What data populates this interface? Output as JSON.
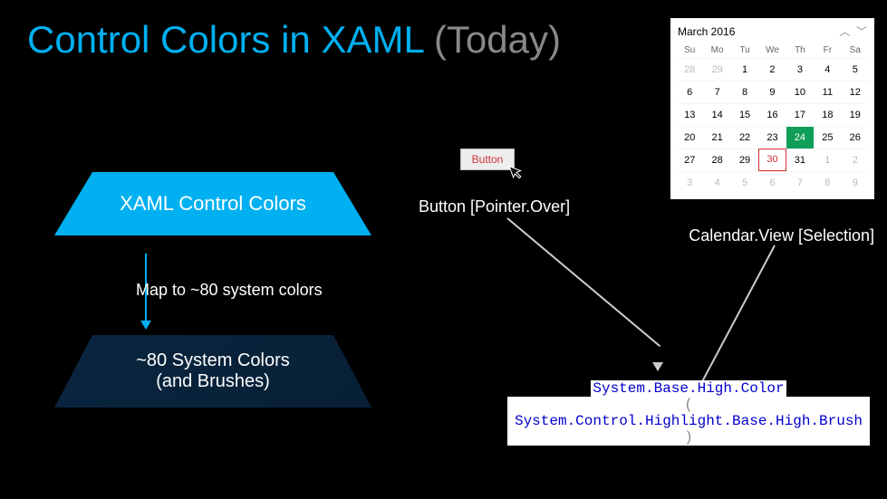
{
  "title": {
    "main": "Control Colors in XAML ",
    "muted": "(Today)"
  },
  "trapTop": "XAML Control Colors",
  "trapBotLine1": "~80 System Colors",
  "trapBotLine2": "(and Brushes)",
  "mapLabel": "Map to ~80 system colors",
  "buttonSample": "Button",
  "buttonLabel": "Button [Pointer.Over]",
  "calendar": {
    "monthLabel": "March 2016",
    "days": [
      "Su",
      "Mo",
      "Tu",
      "We",
      "Th",
      "Fr",
      "Sa"
    ],
    "rows": [
      [
        {
          "v": "28",
          "m": true
        },
        {
          "v": "29",
          "m": true
        },
        {
          "v": "1"
        },
        {
          "v": "2"
        },
        {
          "v": "3"
        },
        {
          "v": "4"
        },
        {
          "v": "5"
        }
      ],
      [
        {
          "v": "6"
        },
        {
          "v": "7"
        },
        {
          "v": "8"
        },
        {
          "v": "9"
        },
        {
          "v": "10"
        },
        {
          "v": "11"
        },
        {
          "v": "12"
        }
      ],
      [
        {
          "v": "13"
        },
        {
          "v": "14"
        },
        {
          "v": "15"
        },
        {
          "v": "16"
        },
        {
          "v": "17"
        },
        {
          "v": "18"
        },
        {
          "v": "19"
        }
      ],
      [
        {
          "v": "20"
        },
        {
          "v": "21"
        },
        {
          "v": "22"
        },
        {
          "v": "23"
        },
        {
          "v": "24",
          "sel": true
        },
        {
          "v": "25"
        },
        {
          "v": "26"
        }
      ],
      [
        {
          "v": "27"
        },
        {
          "v": "28"
        },
        {
          "v": "29"
        },
        {
          "v": "30",
          "today": true
        },
        {
          "v": "31"
        },
        {
          "v": "1",
          "m": true
        },
        {
          "v": "2",
          "m": true
        }
      ],
      [
        {
          "v": "3",
          "m": true
        },
        {
          "v": "4",
          "m": true
        },
        {
          "v": "5",
          "m": true
        },
        {
          "v": "6",
          "m": true
        },
        {
          "v": "7",
          "m": true
        },
        {
          "v": "8",
          "m": true
        },
        {
          "v": "9",
          "m": true
        }
      ]
    ]
  },
  "calendarLabel": "Calendar.View [Selection]",
  "sysColor": {
    "line1": "System.Base.High.Color",
    "line2": "System.Control.Highlight.Base.High.Brush",
    "openParen": "(",
    "closeParen": ")"
  }
}
